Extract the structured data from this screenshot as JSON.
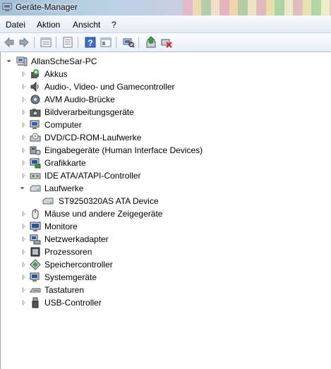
{
  "window": {
    "title": "Geräte-Manager"
  },
  "menu": [
    "Datei",
    "Aktion",
    "Ansicht",
    "?"
  ],
  "toolbar": [
    "back-icon",
    "forward-icon",
    "up-icon",
    "properties-icon",
    "help-icon",
    "view-icon",
    "scan-hardware-icon",
    "update-driver-icon",
    "uninstall-icon"
  ],
  "tree": {
    "root": "AllanScheSar-PC",
    "categories": [
      {
        "label": "Akkus",
        "icon": "battery-icon"
      },
      {
        "label": "Audio-, Video- und Gamecontroller",
        "icon": "speaker-icon"
      },
      {
        "label": "AVM Audio-Brücke",
        "icon": "disc-icon"
      },
      {
        "label": "Bildverarbeitungsgeräte",
        "icon": "camera-icon"
      },
      {
        "label": "Computer",
        "icon": "computer-icon"
      },
      {
        "label": "DVD/CD-ROM-Laufwerke",
        "icon": "dvd-icon"
      },
      {
        "label": "Eingabegeräte (Human Interface Devices)",
        "icon": "hid-icon"
      },
      {
        "label": "Grafikkarte",
        "icon": "graphics-card-icon"
      },
      {
        "label": "IDE ATA/ATAPI-Controller",
        "icon": "ide-controller-icon"
      },
      {
        "label": "Laufwerke",
        "icon": "drive-icon",
        "expanded": true,
        "children": [
          {
            "label": "ST9250320AS ATA Device",
            "icon": "drive-icon"
          }
        ]
      },
      {
        "label": "Mäuse und andere Zeigegeräte",
        "icon": "mouse-icon"
      },
      {
        "label": "Monitore",
        "icon": "monitor-icon"
      },
      {
        "label": "Netzwerkadapter",
        "icon": "network-icon"
      },
      {
        "label": "Prozessoren",
        "icon": "processor-icon"
      },
      {
        "label": "Speichercontroller",
        "icon": "storage-controller-icon"
      },
      {
        "label": "Systemgeräte",
        "icon": "system-devices-icon"
      },
      {
        "label": "Tastaturen",
        "icon": "keyboard-icon"
      },
      {
        "label": "USB-Controller",
        "icon": "usb-icon"
      }
    ]
  },
  "colors": {
    "accent": "#3a6ea5",
    "tree_border": "#9ea9b7"
  }
}
